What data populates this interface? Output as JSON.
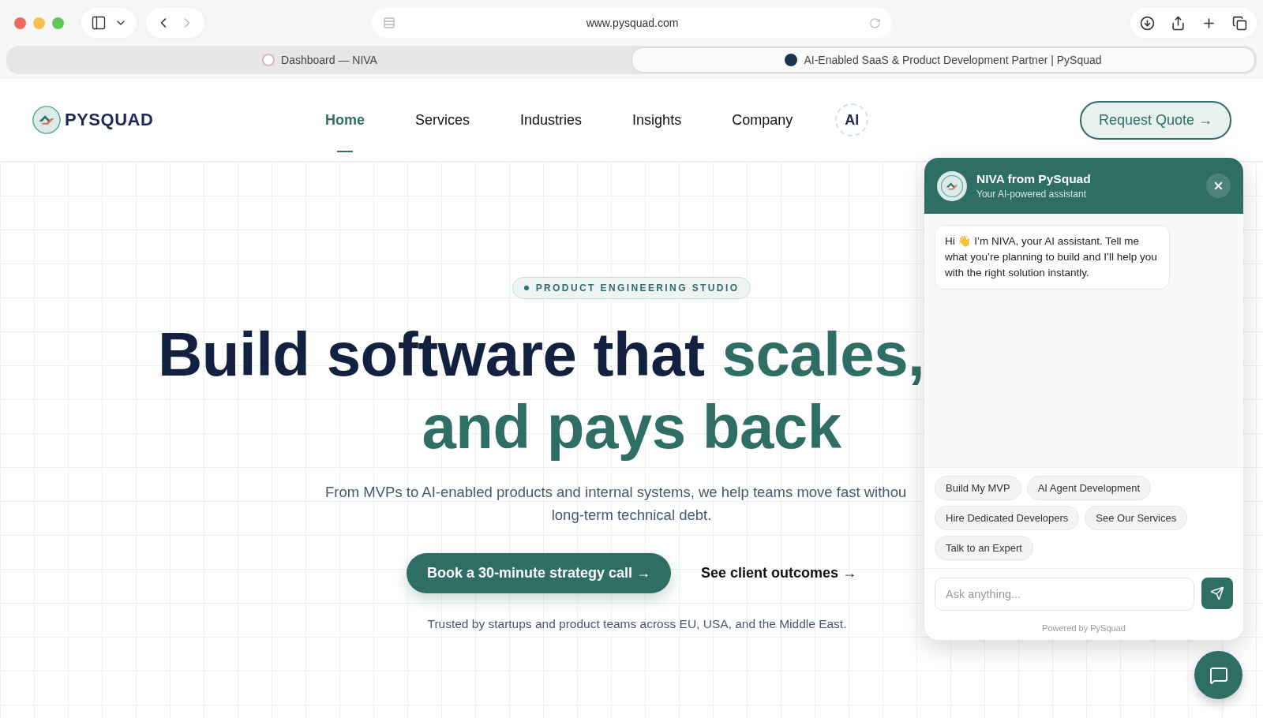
{
  "browser": {
    "url": "www.pysquad.com",
    "tabs": [
      {
        "title": "Dashboard — NIVA",
        "selected": false
      },
      {
        "title": "AI-Enabled SaaS & Product Development Partner | PySquad",
        "selected": true
      }
    ]
  },
  "header": {
    "logo": "PYSQUAD",
    "nav": [
      {
        "label": "Home",
        "selected": true
      },
      {
        "label": "Services",
        "selected": false
      },
      {
        "label": "Industries",
        "selected": false
      },
      {
        "label": "Insights",
        "selected": false
      },
      {
        "label": "Company",
        "selected": false
      }
    ],
    "ai_badge": "AI",
    "cta": "Request Quote →"
  },
  "hero": {
    "badge": "PRODUCT ENGINEERING STUDIO",
    "headline_dark": "Build software that",
    "headline_accent": "scales,",
    "headline_line2": "and pays back",
    "subtitle_lines": [
      "From MVPs to AI-enabled products and internal systems, we help teams move fast withou",
      "long-term technical debt."
    ],
    "primary_button": "Book a 30-minute strategy call →",
    "secondary_link": "See client outcomes →",
    "trust": "Trusted by startups and product teams across EU, USA, and the Middle East."
  },
  "chat": {
    "title": "NIVA from PySquad",
    "subtitle": "Your AI-powered assistant",
    "messages": [
      "Hi 👋 I’m NIVA, your AI assistant. Tell me what you’re planning to build and I’ll help you with the right solution instantly."
    ],
    "suggestions": [
      "Build My MVP",
      "AI Agent Development",
      "Hire Dedicated Developers",
      "See Our Services",
      "Talk to an Expert"
    ],
    "input": {
      "placeholder": "Ask anything..."
    },
    "footer": "Powered by PySquad"
  }
}
